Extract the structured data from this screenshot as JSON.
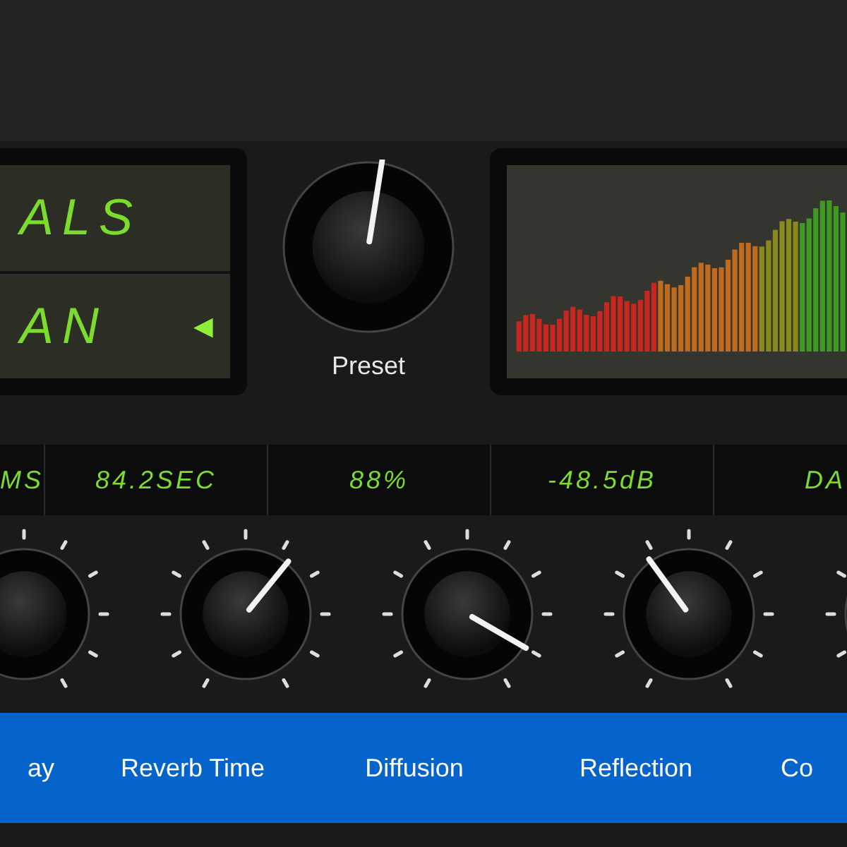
{
  "display": {
    "lines": [
      "ALS",
      "AN"
    ],
    "arrow": "◀"
  },
  "preset": {
    "label": "Preset",
    "level": 0.53
  },
  "readouts": [
    "MS",
    "84.2SEC",
    "88%",
    "-48.5dB",
    "DA"
  ],
  "knobs": [
    {
      "label": "ay"
    },
    {
      "label": "Reverb Time",
      "level": 0.63
    },
    {
      "label": "Diffusion",
      "level": 0.9
    },
    {
      "label": "Reflection",
      "level": 0.38
    },
    {
      "label": "Co"
    }
  ]
}
